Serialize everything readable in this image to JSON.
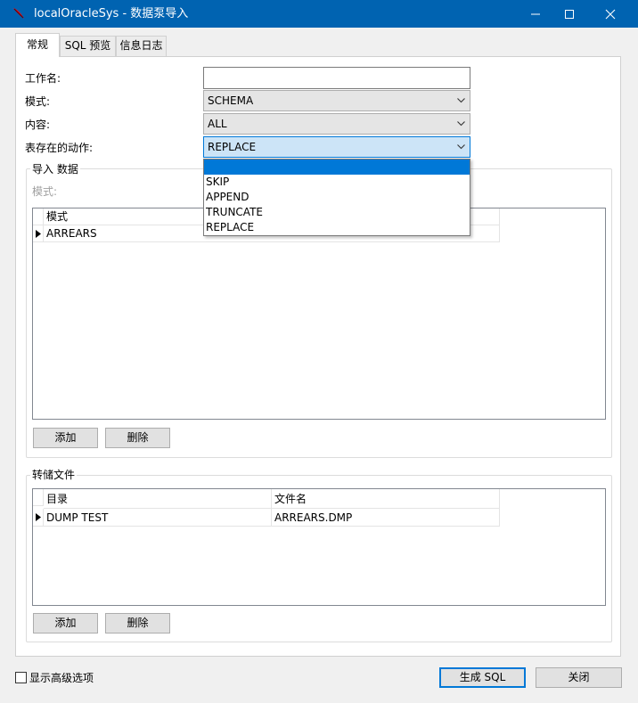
{
  "window": {
    "app_name": "localOracleSys",
    "separator": " - ",
    "dialog_title": "数据泵导入",
    "colors": {
      "titlebar": "#0063b1",
      "accent": "#0078d7"
    }
  },
  "tabs": [
    {
      "label": "常规",
      "active": true
    },
    {
      "label": "SQL 预览",
      "active": false
    },
    {
      "label": "信息日志",
      "active": false
    }
  ],
  "form": {
    "job_name": {
      "label": "工作名:",
      "value": ""
    },
    "mode": {
      "label": "模式:",
      "value": "SCHEMA"
    },
    "content": {
      "label": "内容:",
      "value": "ALL"
    },
    "table_exists_action": {
      "label": "表存在的动作:",
      "value": "REPLACE",
      "options": [
        "",
        "SKIP",
        "APPEND",
        "TRUNCATE",
        "REPLACE"
      ]
    }
  },
  "import_data": {
    "title": "导入 数据",
    "mode_label": "模式:",
    "grid": {
      "headers": [
        "模式"
      ],
      "rows": [
        [
          "ARREARS"
        ]
      ]
    },
    "add_label": "添加",
    "delete_label": "删除"
  },
  "dump_files": {
    "title": "转储文件",
    "grid": {
      "headers": [
        "目录",
        "文件名"
      ],
      "rows": [
        [
          "DUMP TEST",
          "ARREARS.DMP"
        ]
      ]
    },
    "add_label": "添加",
    "delete_label": "删除"
  },
  "footer": {
    "advanced_label": "显示高级选项",
    "advanced_checked": false,
    "generate_sql_label": "生成 SQL",
    "close_label": "关闭"
  },
  "icons": {
    "app": "oracle-feather-icon",
    "minimize": "minimize-icon",
    "maximize": "maximize-icon",
    "close": "close-icon",
    "dropdown": "chevron-down-icon",
    "row_marker": "row-pointer-icon"
  }
}
